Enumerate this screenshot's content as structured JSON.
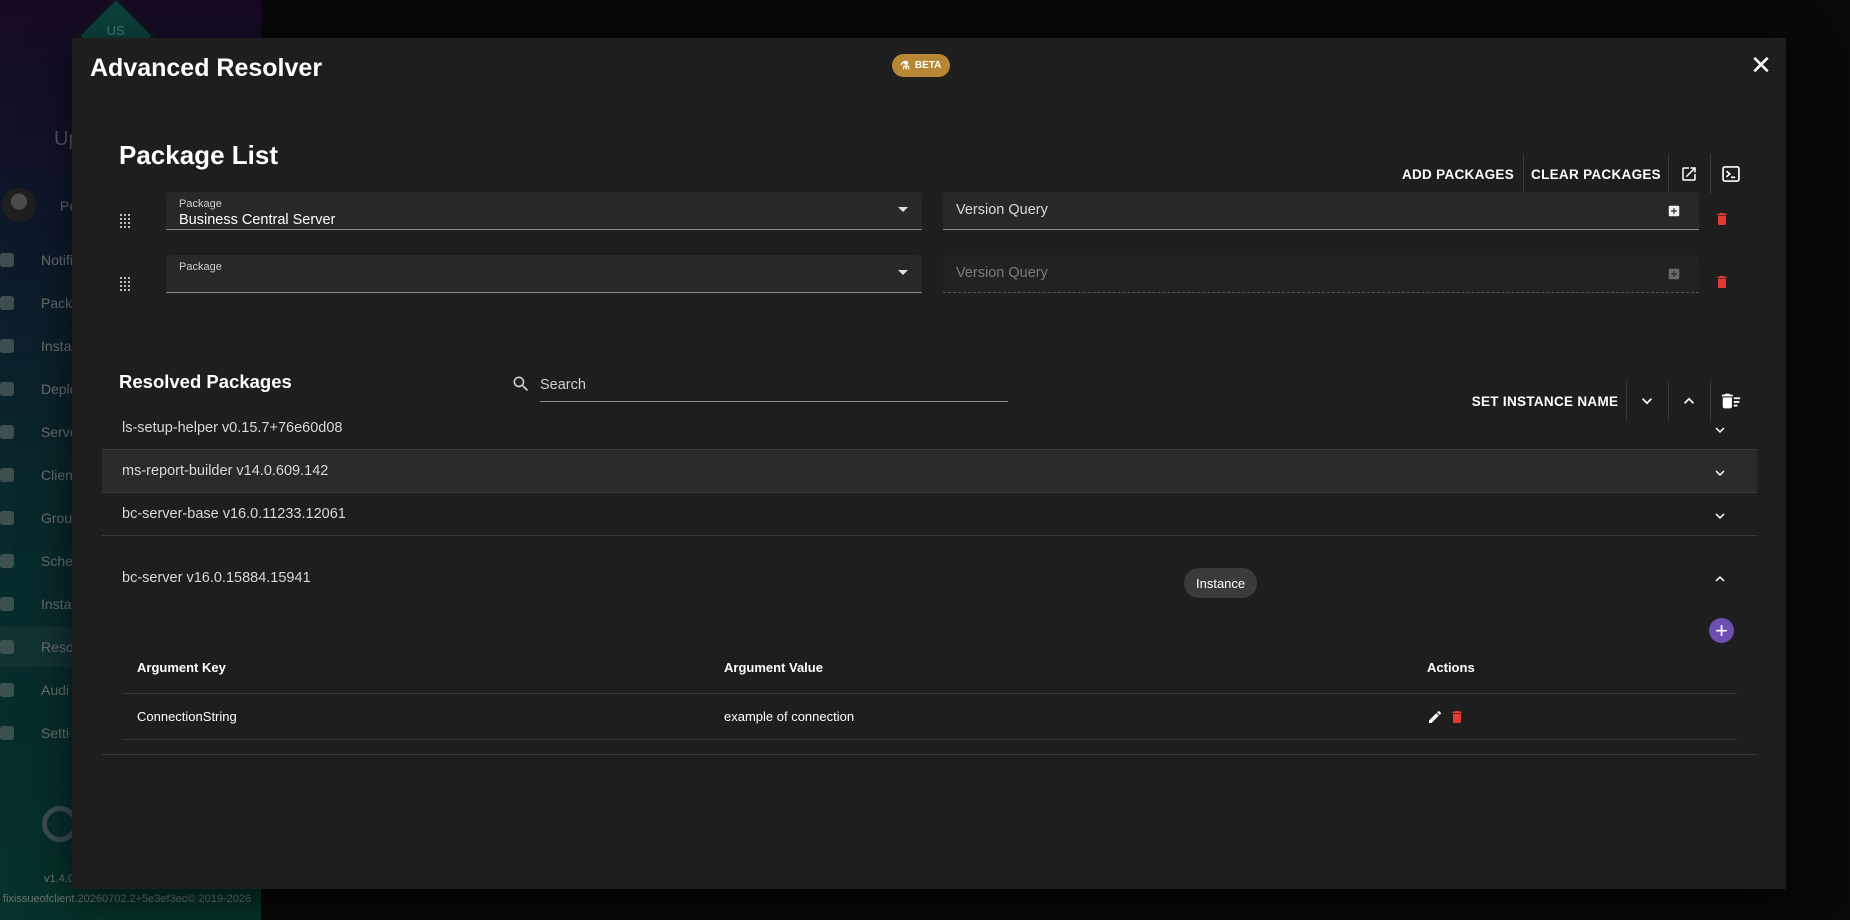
{
  "sidebar": {
    "logo_text": "US",
    "up_text": "Up",
    "user_name": "Pe",
    "items": [
      {
        "label": "Notifi"
      },
      {
        "label": "Packa"
      },
      {
        "label": "Insta"
      },
      {
        "label": "Deplo"
      },
      {
        "label": "Serve"
      },
      {
        "label": "Client"
      },
      {
        "label": "Group"
      },
      {
        "label": "Sche"
      },
      {
        "label": "Insta"
      },
      {
        "label": "Reso"
      },
      {
        "label": "Audi"
      },
      {
        "label": "Setti"
      }
    ],
    "version": "v1.4.0",
    "build": "fixissueofclient.20260702.2+5e3ef3ec© 2019-2026"
  },
  "dialog": {
    "title": "Advanced Resolver",
    "beta_badge": "BETA",
    "close_symbol": "✕"
  },
  "package_list": {
    "title": "Package List",
    "add_packages": "ADD PACKAGES",
    "clear_packages": "CLEAR PACKAGES",
    "rows": [
      {
        "package_label": "Package",
        "package_value": "Business Central Server",
        "version_placeholder": "Version Query"
      },
      {
        "package_label": "Package",
        "package_value": "",
        "version_placeholder": "Version Query"
      }
    ]
  },
  "resolved": {
    "title": "Resolved Packages",
    "search_placeholder": "Search",
    "set_instance_name": "SET INSTANCE NAME",
    "packages": [
      {
        "name": "ls-setup-helper v0.15.7+76e60d08"
      },
      {
        "name": "ms-report-builder v14.0.609.142"
      },
      {
        "name": "bc-server-base v16.0.11233.12061"
      },
      {
        "name": "bc-server v16.0.15884.15941",
        "chip": "Instance"
      }
    ],
    "table": {
      "headers": [
        "Argument Key",
        "Argument Value",
        "Actions"
      ],
      "rows": [
        {
          "key": "ConnectionString",
          "value": "example of connection"
        }
      ]
    }
  },
  "colors": {
    "accent_purple": "#6d4fb1",
    "delete_red": "#e53935",
    "beta_gold": "#b88733"
  }
}
